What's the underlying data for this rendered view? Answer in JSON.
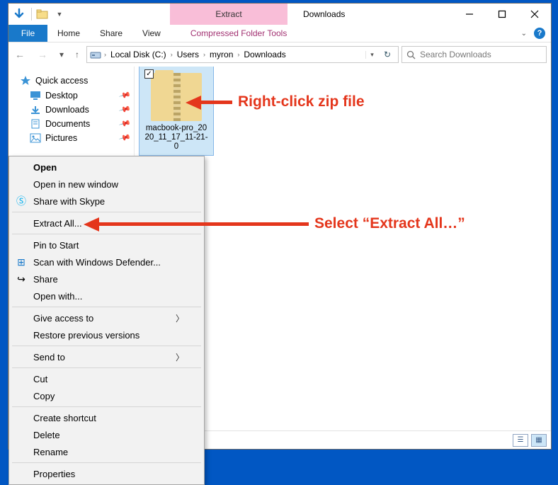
{
  "window": {
    "title": "Downloads",
    "contextual_tab": "Extract",
    "contextual_tools_label": "Compressed Folder Tools"
  },
  "ribbon": {
    "file": "File",
    "tabs": [
      "Home",
      "Share",
      "View"
    ]
  },
  "address": {
    "crumbs": [
      "Local Disk (C:)",
      "Users",
      "myron",
      "Downloads"
    ],
    "search_placeholder": "Search Downloads"
  },
  "nav": {
    "quick_access": "Quick access",
    "items": [
      {
        "label": "Desktop",
        "icon": "desktop-icon"
      },
      {
        "label": "Downloads",
        "icon": "downloads-icon"
      },
      {
        "label": "Documents",
        "icon": "documents-icon"
      },
      {
        "label": "Pictures",
        "icon": "pictures-icon"
      }
    ]
  },
  "file": {
    "name": "macbook-pro_2020_11_17_11-21-0",
    "checked": true
  },
  "context_menu": {
    "open": "Open",
    "open_new_window": "Open in new window",
    "share_skype": "Share with Skype",
    "extract_all": "Extract All...",
    "pin_start": "Pin to Start",
    "scan_defender": "Scan with Windows Defender...",
    "share": "Share",
    "open_with": "Open with...",
    "give_access": "Give access to",
    "restore": "Restore previous versions",
    "send_to": "Send to",
    "cut": "Cut",
    "copy": "Copy",
    "create_shortcut": "Create shortcut",
    "delete": "Delete",
    "rename": "Rename",
    "properties": "Properties"
  },
  "annotations": {
    "a1": "Right-click zip file",
    "a2": "Select “Extract All…”"
  },
  "icons": {
    "chevron": "›",
    "check": "✓",
    "down": "▾"
  }
}
